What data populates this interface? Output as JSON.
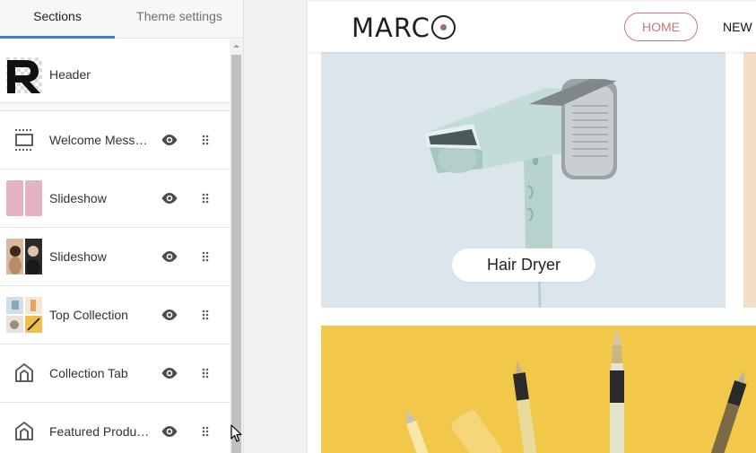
{
  "sidebar": {
    "tabs": [
      {
        "label": "Sections"
      },
      {
        "label": "Theme settings"
      }
    ],
    "header_section": {
      "label": "Header"
    },
    "sections": [
      {
        "label": "Welcome Message"
      },
      {
        "label": "Slideshow"
      },
      {
        "label": "Slideshow"
      },
      {
        "label": "Top Collection"
      },
      {
        "label": "Collection Tab"
      },
      {
        "label": "Featured Products"
      }
    ]
  },
  "preview": {
    "logo": {
      "text": "MARC"
    },
    "nav": {
      "home": "HOME",
      "new": "NEW IN"
    },
    "slide": {
      "caption": "Hair Dryer"
    }
  },
  "colors": {
    "accent": "#3d7bd4",
    "brand_rose": "#c07a7a",
    "slide_bg": "#dbe5ec",
    "promo_bg": "#f2c84b"
  }
}
